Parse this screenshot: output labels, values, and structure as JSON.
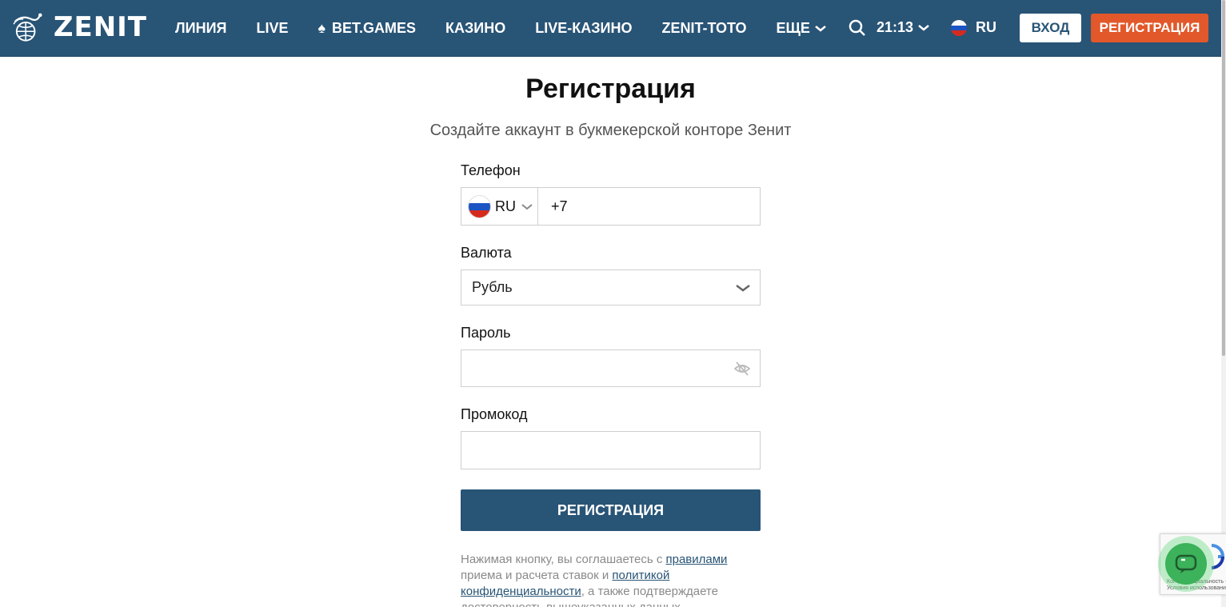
{
  "header": {
    "brand": "ZENIT",
    "nav": [
      {
        "label": "ЛИНИЯ"
      },
      {
        "label": "LIVE"
      },
      {
        "label": "BET.GAMES",
        "icon": "spade-icon"
      },
      {
        "label": "КАЗИНО"
      },
      {
        "label": "LIVE-КАЗИНО"
      },
      {
        "label": "ZENIT-ТОТО"
      },
      {
        "label": "ЕЩЕ",
        "icon": "chevron-down-icon"
      }
    ],
    "time": "21:13",
    "language": "RU",
    "login_label": "ВХОД",
    "register_label": "РЕГИСТРАЦИЯ",
    "colors": {
      "header_bg": "#285476",
      "accent": "#e2582a"
    }
  },
  "form": {
    "title": "Регистрация",
    "subtitle": "Создайте аккаунт в букмекерской конторе Зенит",
    "phone_label": "Телефон",
    "phone_country": "RU",
    "phone_prefix": "+7",
    "currency_label": "Валюта",
    "currency_value": "Рубль",
    "password_label": "Пароль",
    "password_value": "",
    "promo_label": "Промокод",
    "promo_value": "",
    "submit_label": "РЕГИСТРАЦИЯ",
    "terms": {
      "part1": "Нажимая кнопку, вы соглашаетесь с ",
      "link1": "правилами",
      "part2": " приема и расчета ставок и ",
      "link2": "политикой конфиденциальности",
      "part3": ", а также подтверждаете достоверность вышеуказанных данных"
    }
  },
  "widgets": {
    "recaptcha_text_1": "Конфиденциальность -",
    "recaptcha_text_2": "Условия использования"
  }
}
